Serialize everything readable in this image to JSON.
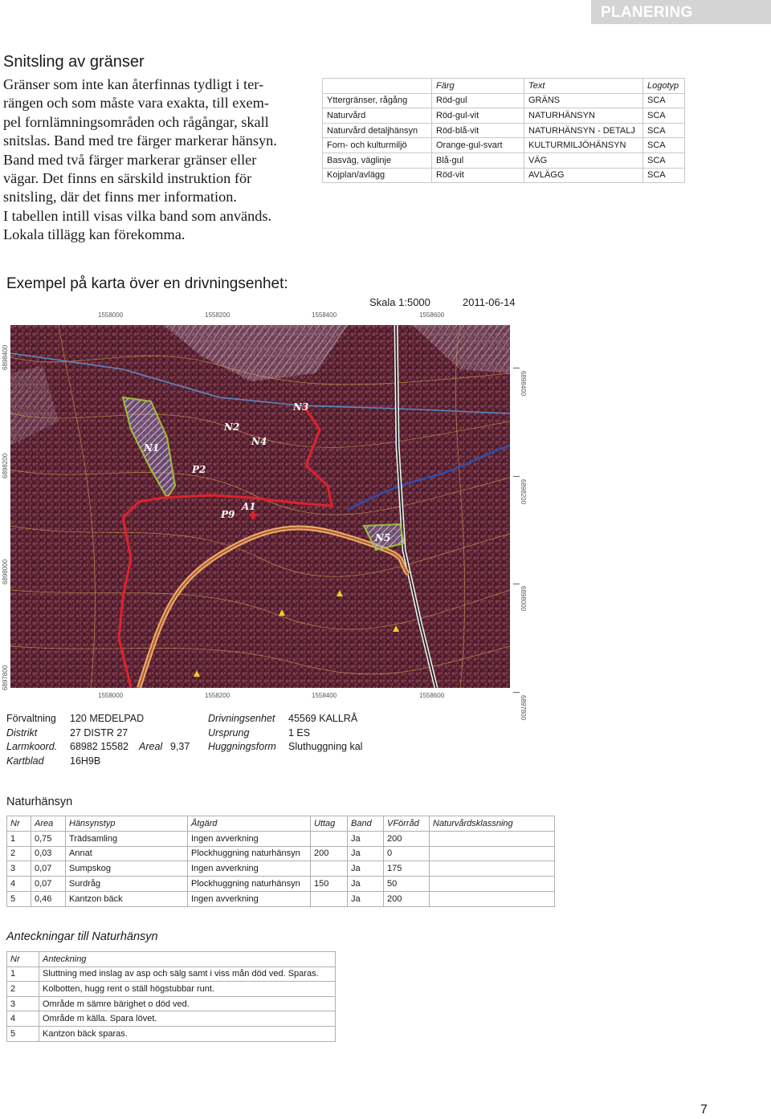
{
  "header": {
    "label": "PLANERING"
  },
  "section": {
    "title": "Snitsling av gränser",
    "intro_lines": [
      "Gränser som inte kan återfinnas tydligt i ter-",
      "rängen och som måste vara exakta, till exem-",
      "pel fornlämningsområden och rågångar, skall",
      "snitslas. Band med tre färger markerar hänsyn.",
      "Band med två färger markerar gränser eller",
      "vägar. Det finns en särskild instruktion för",
      "snitsling, där det finns mer information.",
      "I tabellen intill visas vilka band som används.",
      "Lokala tillägg kan förekomma."
    ]
  },
  "band_table": {
    "headers": [
      "",
      "Färg",
      "Text",
      "Logotyp"
    ],
    "rows": [
      [
        "Yttergränser, rågång",
        "Röd-gul",
        "GRÄNS",
        "SCA"
      ],
      [
        "Naturvård",
        "Röd-gul-vit",
        "NATURHÄNSYN",
        "SCA"
      ],
      [
        "Naturvård detaljhänsyn",
        "Röd-blå-vit",
        "NATURHÄNSYN - DETALJ",
        "SCA"
      ],
      [
        "Forn- och kulturmiljö",
        "Orange-gul-svart",
        "KULTURMILJÖHÄNSYN",
        "SCA"
      ],
      [
        "Basväg, väglinje",
        "Blå-gul",
        "VÄG",
        "SCA"
      ],
      [
        "Kojplan/avlägg",
        "Röd-vit",
        "AVLÄGG",
        "SCA"
      ]
    ]
  },
  "map": {
    "title": "Exempel på karta över en drivningsenhet:",
    "scale": "Skala 1:5000",
    "date": "2011-06-14",
    "x_ticks": [
      "1558000",
      "1558200",
      "1558400",
      "1558600"
    ],
    "y_ticks_left": [
      "6898400",
      "6898200",
      "6898000",
      "6897800"
    ],
    "y_ticks_right": [
      "6898400",
      "6898200",
      "6898000",
      "6897800"
    ],
    "labels": [
      "N3",
      "N2",
      "N4",
      "N1",
      "P2",
      "A1",
      "P9",
      "N5"
    ]
  },
  "info": {
    "forvaltning_label": "Förvaltning",
    "forvaltning_value": "120 MEDELPAD",
    "distrikt_label": "Distrikt",
    "distrikt_value": "27 DISTR 27",
    "larmkoord_label": "Larmkoord.",
    "larmkoord_value": "68982 15582",
    "areal_label": "Areal",
    "areal_value": "9,37",
    "kartblad_label": "Kartblad",
    "kartblad_value": "16H9B",
    "drivningsenhet_label": "Drivningsenhet",
    "drivningsenhet_value": "45569 KALLRÅ",
    "ursprung_label": "Ursprung",
    "ursprung_value": "1 ES",
    "huggningsform_label": "Huggningsform",
    "huggningsform_value": "Sluthuggning kal"
  },
  "naturhansyn": {
    "title": "Naturhänsyn",
    "headers": [
      "Nr",
      "Area",
      "Hänsynstyp",
      "Åtgärd",
      "Uttag",
      "Band",
      "VFörråd",
      "Naturvårdsklassning"
    ],
    "rows": [
      [
        "1",
        "0,75",
        "Trädsamling",
        "Ingen avverkning",
        "",
        "Ja",
        "200",
        ""
      ],
      [
        "2",
        "0,03",
        "Annat",
        "Plockhuggning naturhänsyn",
        "200",
        "Ja",
        "0",
        ""
      ],
      [
        "3",
        "0,07",
        "Sumpskog",
        "Ingen avverkning",
        "",
        "Ja",
        "175",
        ""
      ],
      [
        "4",
        "0,07",
        "Surdråg",
        "Plockhuggning naturhänsyn",
        "150",
        "Ja",
        "50",
        ""
      ],
      [
        "5",
        "0,46",
        "Kantzon bäck",
        "Ingen avverkning",
        "",
        "Ja",
        "200",
        ""
      ]
    ]
  },
  "anteckningar": {
    "title": "Anteckningar till Naturhänsyn",
    "headers": [
      "Nr",
      "Anteckning"
    ],
    "rows": [
      [
        "1",
        "Sluttning med inslag av asp och sälg samt i viss mån död ved. Sparas."
      ],
      [
        "2",
        "Kolbotten, hugg rent o ställ högstubbar runt."
      ],
      [
        "3",
        "Område m sämre bärighet o död ved."
      ],
      [
        "4",
        "Område m källa. Spara lövet."
      ],
      [
        "5",
        "Kantzon bäck sparas."
      ]
    ]
  },
  "page_number": "7"
}
